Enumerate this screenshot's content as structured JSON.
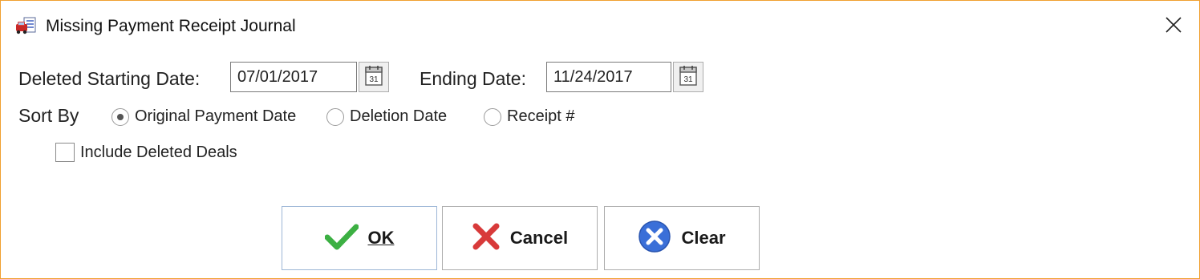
{
  "window": {
    "title": "Missing Payment Receipt Journal",
    "border_color": "#f0a030"
  },
  "filters": {
    "start_label": "Deleted Starting Date:",
    "start_value": "07/01/2017",
    "end_label": "Ending Date:",
    "end_value": "11/24/2017"
  },
  "sort": {
    "label": "Sort By",
    "options": [
      {
        "label": "Original Payment Date",
        "selected": true
      },
      {
        "label": "Deletion Date",
        "selected": false
      },
      {
        "label": "Receipt #",
        "selected": false
      }
    ]
  },
  "include_deleted": {
    "label": "Include Deleted Deals",
    "checked": false
  },
  "buttons": {
    "ok": {
      "label": "OK",
      "icon": "check-icon"
    },
    "cancel": {
      "label": "Cancel",
      "icon": "x-icon"
    },
    "clear": {
      "label": "Clear",
      "icon": "clear-circle-icon"
    }
  },
  "icons": {
    "app": "car-report-icon",
    "close": "close-icon",
    "calendar": "calendar-icon"
  },
  "colors": {
    "ok_green": "#3cb043",
    "cancel_red": "#d83a3a",
    "clear_blue": "#3a6fd8"
  }
}
